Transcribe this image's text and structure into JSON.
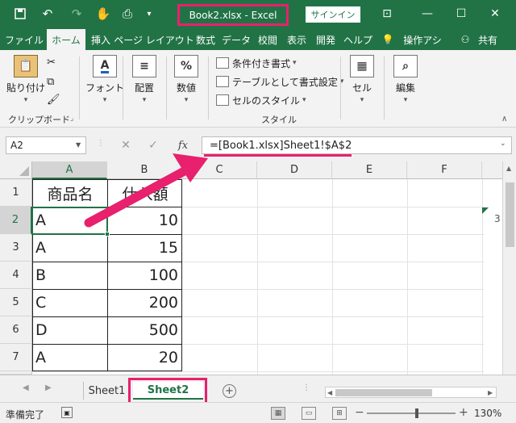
{
  "window": {
    "title": "Book2.xlsx  -  Excel",
    "signin_label": "サインイン"
  },
  "tabs": [
    {
      "label": "ファイル",
      "active": false
    },
    {
      "label": "ホーム",
      "active": true
    },
    {
      "label": "挿入",
      "active": false
    },
    {
      "label": "ページ レイアウト",
      "active": false
    },
    {
      "label": "数式",
      "active": false
    },
    {
      "label": "データ",
      "active": false
    },
    {
      "label": "校閲",
      "active": false
    },
    {
      "label": "表示",
      "active": false
    },
    {
      "label": "開発",
      "active": false
    },
    {
      "label": "ヘルプ",
      "active": false
    },
    {
      "label": "操作アシ",
      "active": false
    },
    {
      "label": "共有",
      "active": false
    }
  ],
  "ribbon": {
    "paste_label": "貼り付け",
    "clipboard_label": "クリップボード",
    "font_label": "フォント",
    "alignment_label": "配置",
    "number_label": "数値",
    "percent_glyph": "%",
    "conditional_label": "条件付き書式",
    "table_label": "テーブルとして書式設定",
    "cellstyle_label": "セルのスタイル",
    "styles_label": "スタイル",
    "cells_label": "セル",
    "editing_label": "編集"
  },
  "formula_bar": {
    "name_box": "A2",
    "fx_label": "fx",
    "formula": "=[Book1.xlsx]Sheet1!$A$2"
  },
  "grid": {
    "columns": [
      "A",
      "B",
      "C",
      "D",
      "E",
      "F"
    ],
    "rows": [
      "1",
      "2",
      "3",
      "4",
      "5",
      "6",
      "7"
    ],
    "selected_cell": "A2",
    "cells": [
      [
        "商品名",
        "仕入額"
      ],
      [
        "A",
        "10"
      ],
      [
        "A",
        "15"
      ],
      [
        "B",
        "100"
      ],
      [
        "C",
        "200"
      ],
      [
        "D",
        "500"
      ],
      [
        "A",
        "20"
      ]
    ],
    "overflow_text": "3"
  },
  "sheets": [
    {
      "name": "Sheet1",
      "active": false
    },
    {
      "name": "Sheet2",
      "active": true
    }
  ],
  "status": {
    "ready": "準備完了",
    "zoom": "130%"
  },
  "colors": {
    "brand": "#217346",
    "highlight": "#e8206d"
  }
}
